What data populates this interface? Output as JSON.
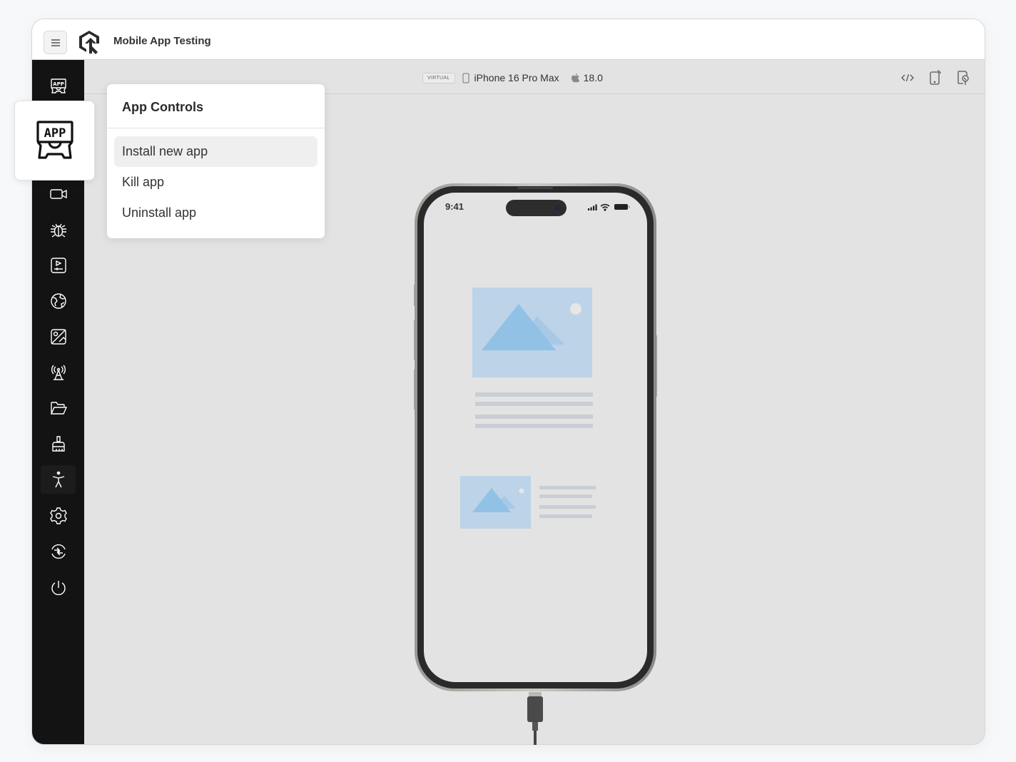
{
  "titlebar": {
    "menu_icon": "hamburger-icon",
    "logo_icon": "lambdatest-logo",
    "title": "Mobile App Testing"
  },
  "sidebar": {
    "items": [
      {
        "icon": "app-controls-icon",
        "label": "App Controls",
        "active": true
      },
      {
        "icon": "video-camera-icon",
        "label": "Recording"
      },
      {
        "icon": "bug-icon",
        "label": "Bug Report"
      },
      {
        "icon": "media-player-icon",
        "label": "Media"
      },
      {
        "icon": "globe-icon",
        "label": "Geolocation"
      },
      {
        "icon": "image-location-icon",
        "label": "Image Injection"
      },
      {
        "icon": "network-tower-icon",
        "label": "Network"
      },
      {
        "icon": "folder-icon",
        "label": "Files"
      },
      {
        "icon": "brush-icon",
        "label": "Clear Data"
      },
      {
        "icon": "accessibility-icon",
        "label": "Accessibility"
      },
      {
        "icon": "gear-icon",
        "label": "Settings"
      },
      {
        "icon": "switch-device-icon",
        "label": "Switch Device"
      },
      {
        "icon": "power-icon",
        "label": "End Session"
      }
    ]
  },
  "device_bar": {
    "badge": "VIRTUAL",
    "device_icon": "phone-icon",
    "device_name": "iPhone 16 Pro Max",
    "os_icon": "apple-icon",
    "os_version": "18.0",
    "tools": [
      {
        "icon": "code-icon",
        "label": "Developer Tools"
      },
      {
        "icon": "device-rotate-icon",
        "label": "Rotate"
      },
      {
        "icon": "inspect-icon",
        "label": "Inspector"
      }
    ]
  },
  "app_menu": {
    "title": "App Controls",
    "items": [
      {
        "label": "Install new app",
        "hovered": true
      },
      {
        "label": "Kill app"
      },
      {
        "label": "Uninstall app"
      }
    ]
  },
  "phone": {
    "time": "9:41",
    "colors": {
      "image_bg": "#bcd3e8",
      "mountain": "#92c1e6",
      "text_line": "#c9ced5",
      "screen": "#e3e3e3",
      "bezel": "#2a2a2a"
    }
  }
}
